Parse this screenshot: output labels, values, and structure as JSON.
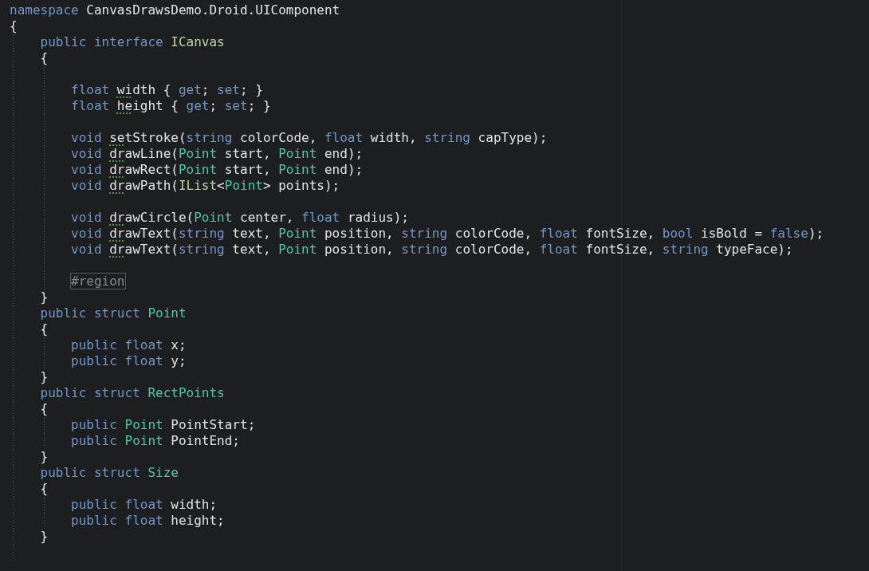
{
  "editor": {
    "lines": [
      {
        "kind": "code",
        "tokens": [
          {
            "text": "namespace ",
            "kind": "keyword"
          },
          {
            "text": "CanvasDrawsDemo.Droid.UIComponent",
            "kind": "plain"
          }
        ]
      },
      {
        "kind": "code",
        "tokens": [
          {
            "text": "{",
            "kind": "plain"
          }
        ]
      },
      {
        "kind": "code",
        "tokens": [
          {
            "text": "\tpublic interface ",
            "kind": "keyword"
          },
          {
            "text": "ICanvas",
            "kind": "interface"
          }
        ]
      },
      {
        "kind": "code",
        "tokens": [
          {
            "text": "\t{",
            "kind": "plain"
          }
        ]
      },
      {
        "kind": "blank"
      },
      {
        "kind": "code",
        "tokens": [
          {
            "text": "\t\tfloat ",
            "kind": "keyword"
          },
          {
            "text": "wi",
            "kind": "hint"
          },
          {
            "text": "dth { ",
            "kind": "plain"
          },
          {
            "text": "get",
            "kind": "keyword"
          },
          {
            "text": "; ",
            "kind": "plain"
          },
          {
            "text": "set",
            "kind": "keyword"
          },
          {
            "text": "; }",
            "kind": "plain"
          }
        ]
      },
      {
        "kind": "code",
        "tokens": [
          {
            "text": "\t\tfloat ",
            "kind": "keyword"
          },
          {
            "text": "he",
            "kind": "hint"
          },
          {
            "text": "ight { ",
            "kind": "plain"
          },
          {
            "text": "get",
            "kind": "keyword"
          },
          {
            "text": "; ",
            "kind": "plain"
          },
          {
            "text": "set",
            "kind": "keyword"
          },
          {
            "text": "; }",
            "kind": "plain"
          }
        ]
      },
      {
        "kind": "blank"
      },
      {
        "kind": "code",
        "tokens": [
          {
            "text": "\t\tvoid ",
            "kind": "keyword"
          },
          {
            "text": "se",
            "kind": "hint"
          },
          {
            "text": "tStroke(",
            "kind": "plain"
          },
          {
            "text": "string",
            "kind": "keyword"
          },
          {
            "text": " colorCode, ",
            "kind": "plain"
          },
          {
            "text": "float",
            "kind": "keyword"
          },
          {
            "text": " width, ",
            "kind": "plain"
          },
          {
            "text": "string",
            "kind": "keyword"
          },
          {
            "text": " capType);",
            "kind": "plain"
          }
        ]
      },
      {
        "kind": "code",
        "tokens": [
          {
            "text": "\t\tvoid ",
            "kind": "keyword"
          },
          {
            "text": "dr",
            "kind": "hint"
          },
          {
            "text": "awLine(",
            "kind": "plain"
          },
          {
            "text": "Point",
            "kind": "type"
          },
          {
            "text": " start, ",
            "kind": "plain"
          },
          {
            "text": "Point",
            "kind": "type"
          },
          {
            "text": " end);",
            "kind": "plain"
          }
        ]
      },
      {
        "kind": "code",
        "tokens": [
          {
            "text": "\t\tvoid ",
            "kind": "keyword"
          },
          {
            "text": "dr",
            "kind": "hint"
          },
          {
            "text": "awRect(",
            "kind": "plain"
          },
          {
            "text": "Point",
            "kind": "type"
          },
          {
            "text": " start, ",
            "kind": "plain"
          },
          {
            "text": "Point",
            "kind": "type"
          },
          {
            "text": " end);",
            "kind": "plain"
          }
        ]
      },
      {
        "kind": "code",
        "tokens": [
          {
            "text": "\t\tvoid ",
            "kind": "keyword"
          },
          {
            "text": "dr",
            "kind": "hint"
          },
          {
            "text": "awPath(",
            "kind": "plain"
          },
          {
            "text": "IList",
            "kind": "interface"
          },
          {
            "text": "<",
            "kind": "plain"
          },
          {
            "text": "Point",
            "kind": "type"
          },
          {
            "text": "> points);",
            "kind": "plain"
          }
        ]
      },
      {
        "kind": "blank"
      },
      {
        "kind": "code",
        "tokens": [
          {
            "text": "\t\tvoid ",
            "kind": "keyword"
          },
          {
            "text": "dr",
            "kind": "hint"
          },
          {
            "text": "awCircle(",
            "kind": "plain"
          },
          {
            "text": "Point",
            "kind": "type"
          },
          {
            "text": " center, ",
            "kind": "plain"
          },
          {
            "text": "float",
            "kind": "keyword"
          },
          {
            "text": " radius);",
            "kind": "plain"
          }
        ]
      },
      {
        "kind": "code",
        "tokens": [
          {
            "text": "\t\tvoid ",
            "kind": "keyword"
          },
          {
            "text": "dr",
            "kind": "hint"
          },
          {
            "text": "awText(",
            "kind": "plain"
          },
          {
            "text": "string",
            "kind": "keyword"
          },
          {
            "text": " text, ",
            "kind": "plain"
          },
          {
            "text": "Point",
            "kind": "type"
          },
          {
            "text": " position, ",
            "kind": "plain"
          },
          {
            "text": "string",
            "kind": "keyword"
          },
          {
            "text": " colorCode, ",
            "kind": "plain"
          },
          {
            "text": "float",
            "kind": "keyword"
          },
          {
            "text": " fontSize, ",
            "kind": "plain"
          },
          {
            "text": "bool",
            "kind": "keyword"
          },
          {
            "text": " isBold = ",
            "kind": "plain"
          },
          {
            "text": "false",
            "kind": "keyword"
          },
          {
            "text": ");",
            "kind": "plain"
          }
        ]
      },
      {
        "kind": "code",
        "tokens": [
          {
            "text": "\t\tvoid ",
            "kind": "keyword"
          },
          {
            "text": "dr",
            "kind": "hint"
          },
          {
            "text": "awText(",
            "kind": "plain"
          },
          {
            "text": "string",
            "kind": "keyword"
          },
          {
            "text": " text, ",
            "kind": "plain"
          },
          {
            "text": "Point",
            "kind": "type"
          },
          {
            "text": " position, ",
            "kind": "plain"
          },
          {
            "text": "string",
            "kind": "keyword"
          },
          {
            "text": " colorCode, ",
            "kind": "plain"
          },
          {
            "text": "float",
            "kind": "keyword"
          },
          {
            "text": " fontSize, ",
            "kind": "plain"
          },
          {
            "text": "string",
            "kind": "keyword"
          },
          {
            "text": " typeFace);",
            "kind": "plain"
          }
        ]
      },
      {
        "kind": "blank"
      },
      {
        "kind": "code",
        "tokens": [
          {
            "text": "\t\t#region",
            "kind": "region"
          }
        ]
      },
      {
        "kind": "code",
        "tokens": [
          {
            "text": "\t}",
            "kind": "plain"
          }
        ]
      },
      {
        "kind": "code",
        "tokens": [
          {
            "text": "\tpublic struct ",
            "kind": "keyword"
          },
          {
            "text": "Point",
            "kind": "type"
          }
        ]
      },
      {
        "kind": "code",
        "tokens": [
          {
            "text": "\t{",
            "kind": "plain"
          }
        ]
      },
      {
        "kind": "code",
        "tokens": [
          {
            "text": "\t\tpublic float",
            "kind": "keyword"
          },
          {
            "text": " x;",
            "kind": "plain"
          }
        ]
      },
      {
        "kind": "code",
        "tokens": [
          {
            "text": "\t\tpublic float",
            "kind": "keyword"
          },
          {
            "text": " y;",
            "kind": "plain"
          }
        ]
      },
      {
        "kind": "code",
        "tokens": [
          {
            "text": "\t}",
            "kind": "plain"
          }
        ]
      },
      {
        "kind": "code",
        "tokens": [
          {
            "text": "\tpublic struct ",
            "kind": "keyword"
          },
          {
            "text": "RectPoints",
            "kind": "type"
          }
        ]
      },
      {
        "kind": "code",
        "tokens": [
          {
            "text": "\t{",
            "kind": "plain"
          }
        ]
      },
      {
        "kind": "code",
        "tokens": [
          {
            "text": "\t\tpublic ",
            "kind": "keyword"
          },
          {
            "text": "Point",
            "kind": "type"
          },
          {
            "text": " PointStart;",
            "kind": "plain"
          }
        ]
      },
      {
        "kind": "code",
        "tokens": [
          {
            "text": "\t\tpublic ",
            "kind": "keyword"
          },
          {
            "text": "Point",
            "kind": "type"
          },
          {
            "text": " PointEnd;",
            "kind": "plain"
          }
        ]
      },
      {
        "kind": "code",
        "tokens": [
          {
            "text": "\t}",
            "kind": "plain"
          }
        ]
      },
      {
        "kind": "code",
        "tokens": [
          {
            "text": "\tpublic struct ",
            "kind": "keyword"
          },
          {
            "text": "Size",
            "kind": "type"
          }
        ]
      },
      {
        "kind": "code",
        "tokens": [
          {
            "text": "\t{",
            "kind": "plain"
          }
        ]
      },
      {
        "kind": "code",
        "tokens": [
          {
            "text": "\t\tpublic float",
            "kind": "keyword"
          },
          {
            "text": " width;",
            "kind": "plain"
          }
        ]
      },
      {
        "kind": "code",
        "tokens": [
          {
            "text": "\t\tpublic float",
            "kind": "keyword"
          },
          {
            "text": " height;",
            "kind": "plain"
          }
        ]
      },
      {
        "kind": "code",
        "tokens": [
          {
            "text": "\t}",
            "kind": "plain"
          }
        ]
      },
      {
        "kind": "blank"
      }
    ]
  }
}
